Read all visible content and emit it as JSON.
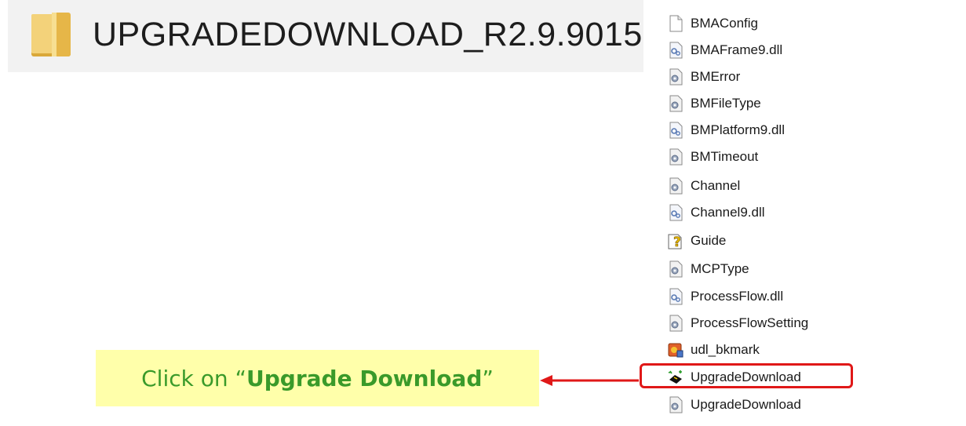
{
  "folder": {
    "title": "UPGRADEDOWNLOAD_R2.9.9015",
    "icon": "folder-icon"
  },
  "files": [
    {
      "label": "BMAConfig",
      "icon": "blank-file-icon"
    },
    {
      "label": "BMAFrame9.dll",
      "icon": "dll-file-icon"
    },
    {
      "label": "BMError",
      "icon": "config-file-icon"
    },
    {
      "label": "BMFileType",
      "icon": "config-file-icon"
    },
    {
      "label": "BMPlatform9.dll",
      "icon": "dll-file-icon"
    },
    {
      "label": "BMTimeout",
      "icon": "config-file-icon"
    },
    {
      "label": "Channel",
      "icon": "config-file-icon"
    },
    {
      "label": "Channel9.dll",
      "icon": "dll-file-icon"
    },
    {
      "label": "Guide",
      "icon": "help-file-icon"
    },
    {
      "label": "MCPType",
      "icon": "config-file-icon"
    },
    {
      "label": "ProcessFlow.dll",
      "icon": "dll-file-icon"
    },
    {
      "label": "ProcessFlowSetting",
      "icon": "config-file-icon"
    },
    {
      "label": "udl_bkmark",
      "icon": "bookmark-file-icon"
    },
    {
      "label": "UpgradeDownload",
      "icon": "app-executable-icon"
    },
    {
      "label": "UpgradeDownload",
      "icon": "config-file-icon"
    }
  ],
  "callout": {
    "prefix": "Click on “",
    "emphasis": "Upgrade Download",
    "suffix": "”"
  },
  "colors": {
    "highlight": "#e01818",
    "callout_bg": "#ffffaa",
    "callout_text": "#3a9a2a"
  }
}
